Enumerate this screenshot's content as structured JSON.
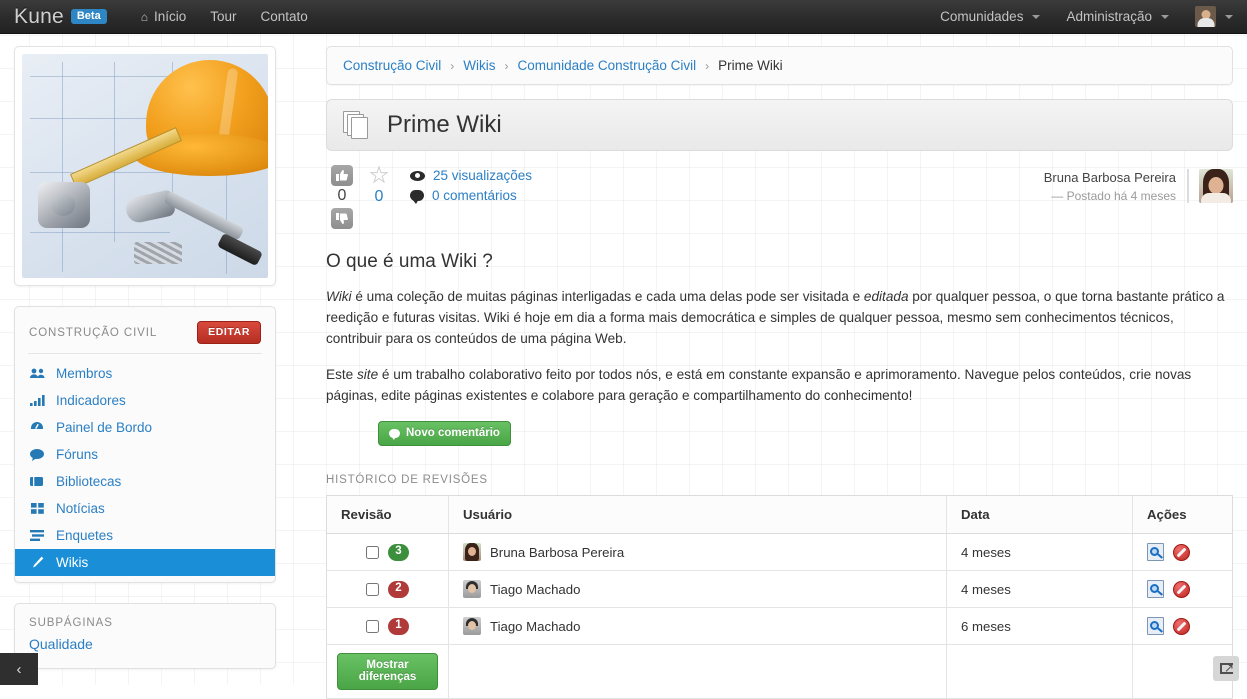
{
  "topbar": {
    "brand": "Kune",
    "beta": "Beta",
    "nav_left": [
      {
        "label": "Início",
        "icon": "home-icon"
      },
      {
        "label": "Tour",
        "icon": ""
      },
      {
        "label": "Contato",
        "icon": ""
      }
    ],
    "nav_right": [
      {
        "label": "Comunidades",
        "caret": true
      },
      {
        "label": "Administração",
        "caret": true
      }
    ],
    "user_menu_caret": "▾"
  },
  "sidebar": {
    "photo_alt": "construction-blueprint-helmet-hammer-photo",
    "community": {
      "title": "CONSTRUÇÃO CIVIL",
      "edit_label": "EDITAR"
    },
    "items": [
      {
        "label": "Membros",
        "icon": "users-icon",
        "glyph": "👥",
        "active": false
      },
      {
        "label": "Indicadores",
        "icon": "bar-chart-icon",
        "glyph": "▂▄▆",
        "active": false
      },
      {
        "label": "Painel de Bordo",
        "icon": "dashboard-icon",
        "glyph": "◕",
        "active": false
      },
      {
        "label": "Fóruns",
        "icon": "comment-icon",
        "glyph": "●",
        "active": false
      },
      {
        "label": "Bibliotecas",
        "icon": "book-icon",
        "glyph": "▤",
        "active": false
      },
      {
        "label": "Notícias",
        "icon": "grid-icon",
        "glyph": "▦",
        "active": false
      },
      {
        "label": "Enquetes",
        "icon": "list-icon",
        "glyph": "☰",
        "active": false
      },
      {
        "label": "Wikis",
        "icon": "pencil-icon",
        "glyph": "✎",
        "active": true
      }
    ],
    "subpages": {
      "title": "SUBPÁGINAS",
      "links": [
        "Qualidade"
      ]
    },
    "collapse_icon": "chevron-left-icon"
  },
  "breadcrumb": {
    "items": [
      {
        "label": "Construção Civil",
        "current": false
      },
      {
        "label": "Wikis",
        "current": false
      },
      {
        "label": "Comunidade Construção Civil",
        "current": false
      },
      {
        "label": "Prime Wiki",
        "current": true
      }
    ],
    "separator": "›"
  },
  "page": {
    "title": "Prime Wiki",
    "title_icon": "pages-stack-icon"
  },
  "stats": {
    "thumbs_up_icon": "thumbs-up-icon",
    "thumbs_up_count": "0",
    "thumbs_down_icon": "thumbs-down-icon",
    "star_icon": "star-outline-icon",
    "star_count": "0",
    "views_icon": "eye-icon",
    "views_label": "25 visualizações",
    "comments_icon": "comment-bubble-icon",
    "comments_label": "0 comentários"
  },
  "author": {
    "name": "Bruna Barbosa Pereira",
    "posted": "— Postado há 4 meses",
    "avatar": "author-avatar"
  },
  "article": {
    "heading": "O que é uma Wiki ?",
    "p1_a": "Wiki",
    "p1_b": " é uma coleção de muitas páginas interligadas e cada uma delas pode ser visitada e ",
    "p1_c": "editada",
    "p1_d": " por qualquer pessoa, o que torna bastante prático a reedição e futuras visitas. Wiki é hoje em dia a forma mais democrática e simples de qualquer pessoa, mesmo sem conhecimentos técnicos, contribuir para os conteúdos de uma página Web.",
    "p2_a": "Este ",
    "p2_b": "site",
    "p2_c": " é um trabalho colaborativo feito por todos nós, e está em constante expansão e aprimoramento. Navegue pelos conteúdos, crie novas páginas, edite páginas existentes e colabore para geração e compartilhamento do conhecimento!",
    "new_comment_label": "Novo comentário"
  },
  "history": {
    "label": "HISTÓRICO DE REVISÕES",
    "columns": [
      "Revisão",
      "Usuário",
      "Data",
      "Ações"
    ],
    "rows": [
      {
        "revision": "3",
        "badge_color": "green",
        "user": "Bruna Barbosa Pereira",
        "avatar_kind": "f",
        "date": "4 meses",
        "view_icon": "view-revision-icon",
        "ban_icon": "revert-ban-icon"
      },
      {
        "revision": "2",
        "badge_color": "red",
        "user": "Tiago Machado",
        "avatar_kind": "m",
        "date": "4 meses",
        "view_icon": "view-revision-icon",
        "ban_icon": "revert-ban-icon"
      },
      {
        "revision": "1",
        "badge_color": "red",
        "user": "Tiago Machado",
        "avatar_kind": "m",
        "date": "6 meses",
        "view_icon": "view-revision-icon",
        "ban_icon": "revert-ban-icon"
      }
    ],
    "show_diff_label": "Mostrar diferenças"
  },
  "share": {
    "icon": "share-export-icon"
  },
  "colors": {
    "link": "#2b7fc4",
    "active_nav": "#1a8fd8",
    "edit_button": "#b52e22",
    "green_button": "#4aa547",
    "badge_green": "#3c8f3c",
    "badge_red": "#b03a3a",
    "topbar": "#2b2b2b"
  }
}
